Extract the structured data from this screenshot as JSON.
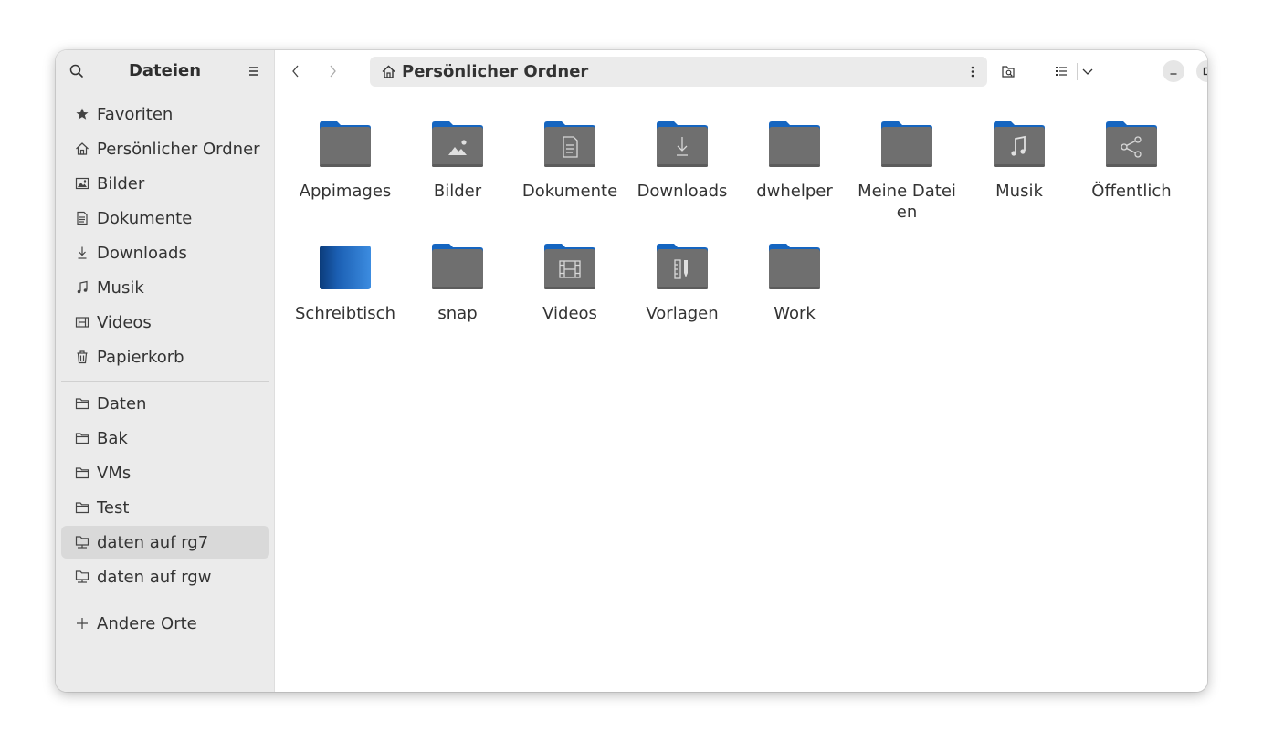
{
  "app": {
    "title": "Dateien"
  },
  "path": {
    "label": "Persönlicher Ordner"
  },
  "sidebar": {
    "places": [
      {
        "label": "Favoriten",
        "icon": "star-icon"
      },
      {
        "label": "Persönlicher Ordner",
        "icon": "home-icon"
      },
      {
        "label": "Bilder",
        "icon": "image-icon"
      },
      {
        "label": "Dokumente",
        "icon": "document-icon"
      },
      {
        "label": "Downloads",
        "icon": "download-icon"
      },
      {
        "label": "Musik",
        "icon": "music-icon"
      },
      {
        "label": "Videos",
        "icon": "film-icon"
      },
      {
        "label": "Papierkorb",
        "icon": "trash-icon"
      }
    ],
    "bookmarks": [
      {
        "label": "Daten",
        "icon": "folder-icon"
      },
      {
        "label": "Bak",
        "icon": "folder-icon"
      },
      {
        "label": "VMs",
        "icon": "folder-icon"
      },
      {
        "label": "Test",
        "icon": "folder-icon"
      },
      {
        "label": "daten auf rg7",
        "icon": "network-folder-icon",
        "active": true
      },
      {
        "label": "daten auf rgw",
        "icon": "network-folder-icon"
      }
    ],
    "other": {
      "label": "Andere Orte",
      "icon": "plus-icon"
    }
  },
  "folders": [
    {
      "name": "Appimages",
      "emblem": "none"
    },
    {
      "name": "Bilder",
      "emblem": "image"
    },
    {
      "name": "Dokumente",
      "emblem": "document"
    },
    {
      "name": "Downloads",
      "emblem": "download"
    },
    {
      "name": "dwhelper",
      "emblem": "none"
    },
    {
      "name": "Meine Dateien",
      "emblem": "none"
    },
    {
      "name": "Musik",
      "emblem": "music"
    },
    {
      "name": "Öffentlich",
      "emblem": "share"
    },
    {
      "name": "Schreibtisch",
      "emblem": "desktop"
    },
    {
      "name": "snap",
      "emblem": "none"
    },
    {
      "name": "Videos",
      "emblem": "film"
    },
    {
      "name": "Vorlagen",
      "emblem": "template"
    },
    {
      "name": "Work",
      "emblem": "none"
    }
  ],
  "colors": {
    "folder_tab": "#1565c0",
    "folder_body": "#6f6f6f",
    "desktop_blue": "#2471c8",
    "sidebar_bg": "#ebebeb",
    "active_item": "#d9d9d9"
  }
}
